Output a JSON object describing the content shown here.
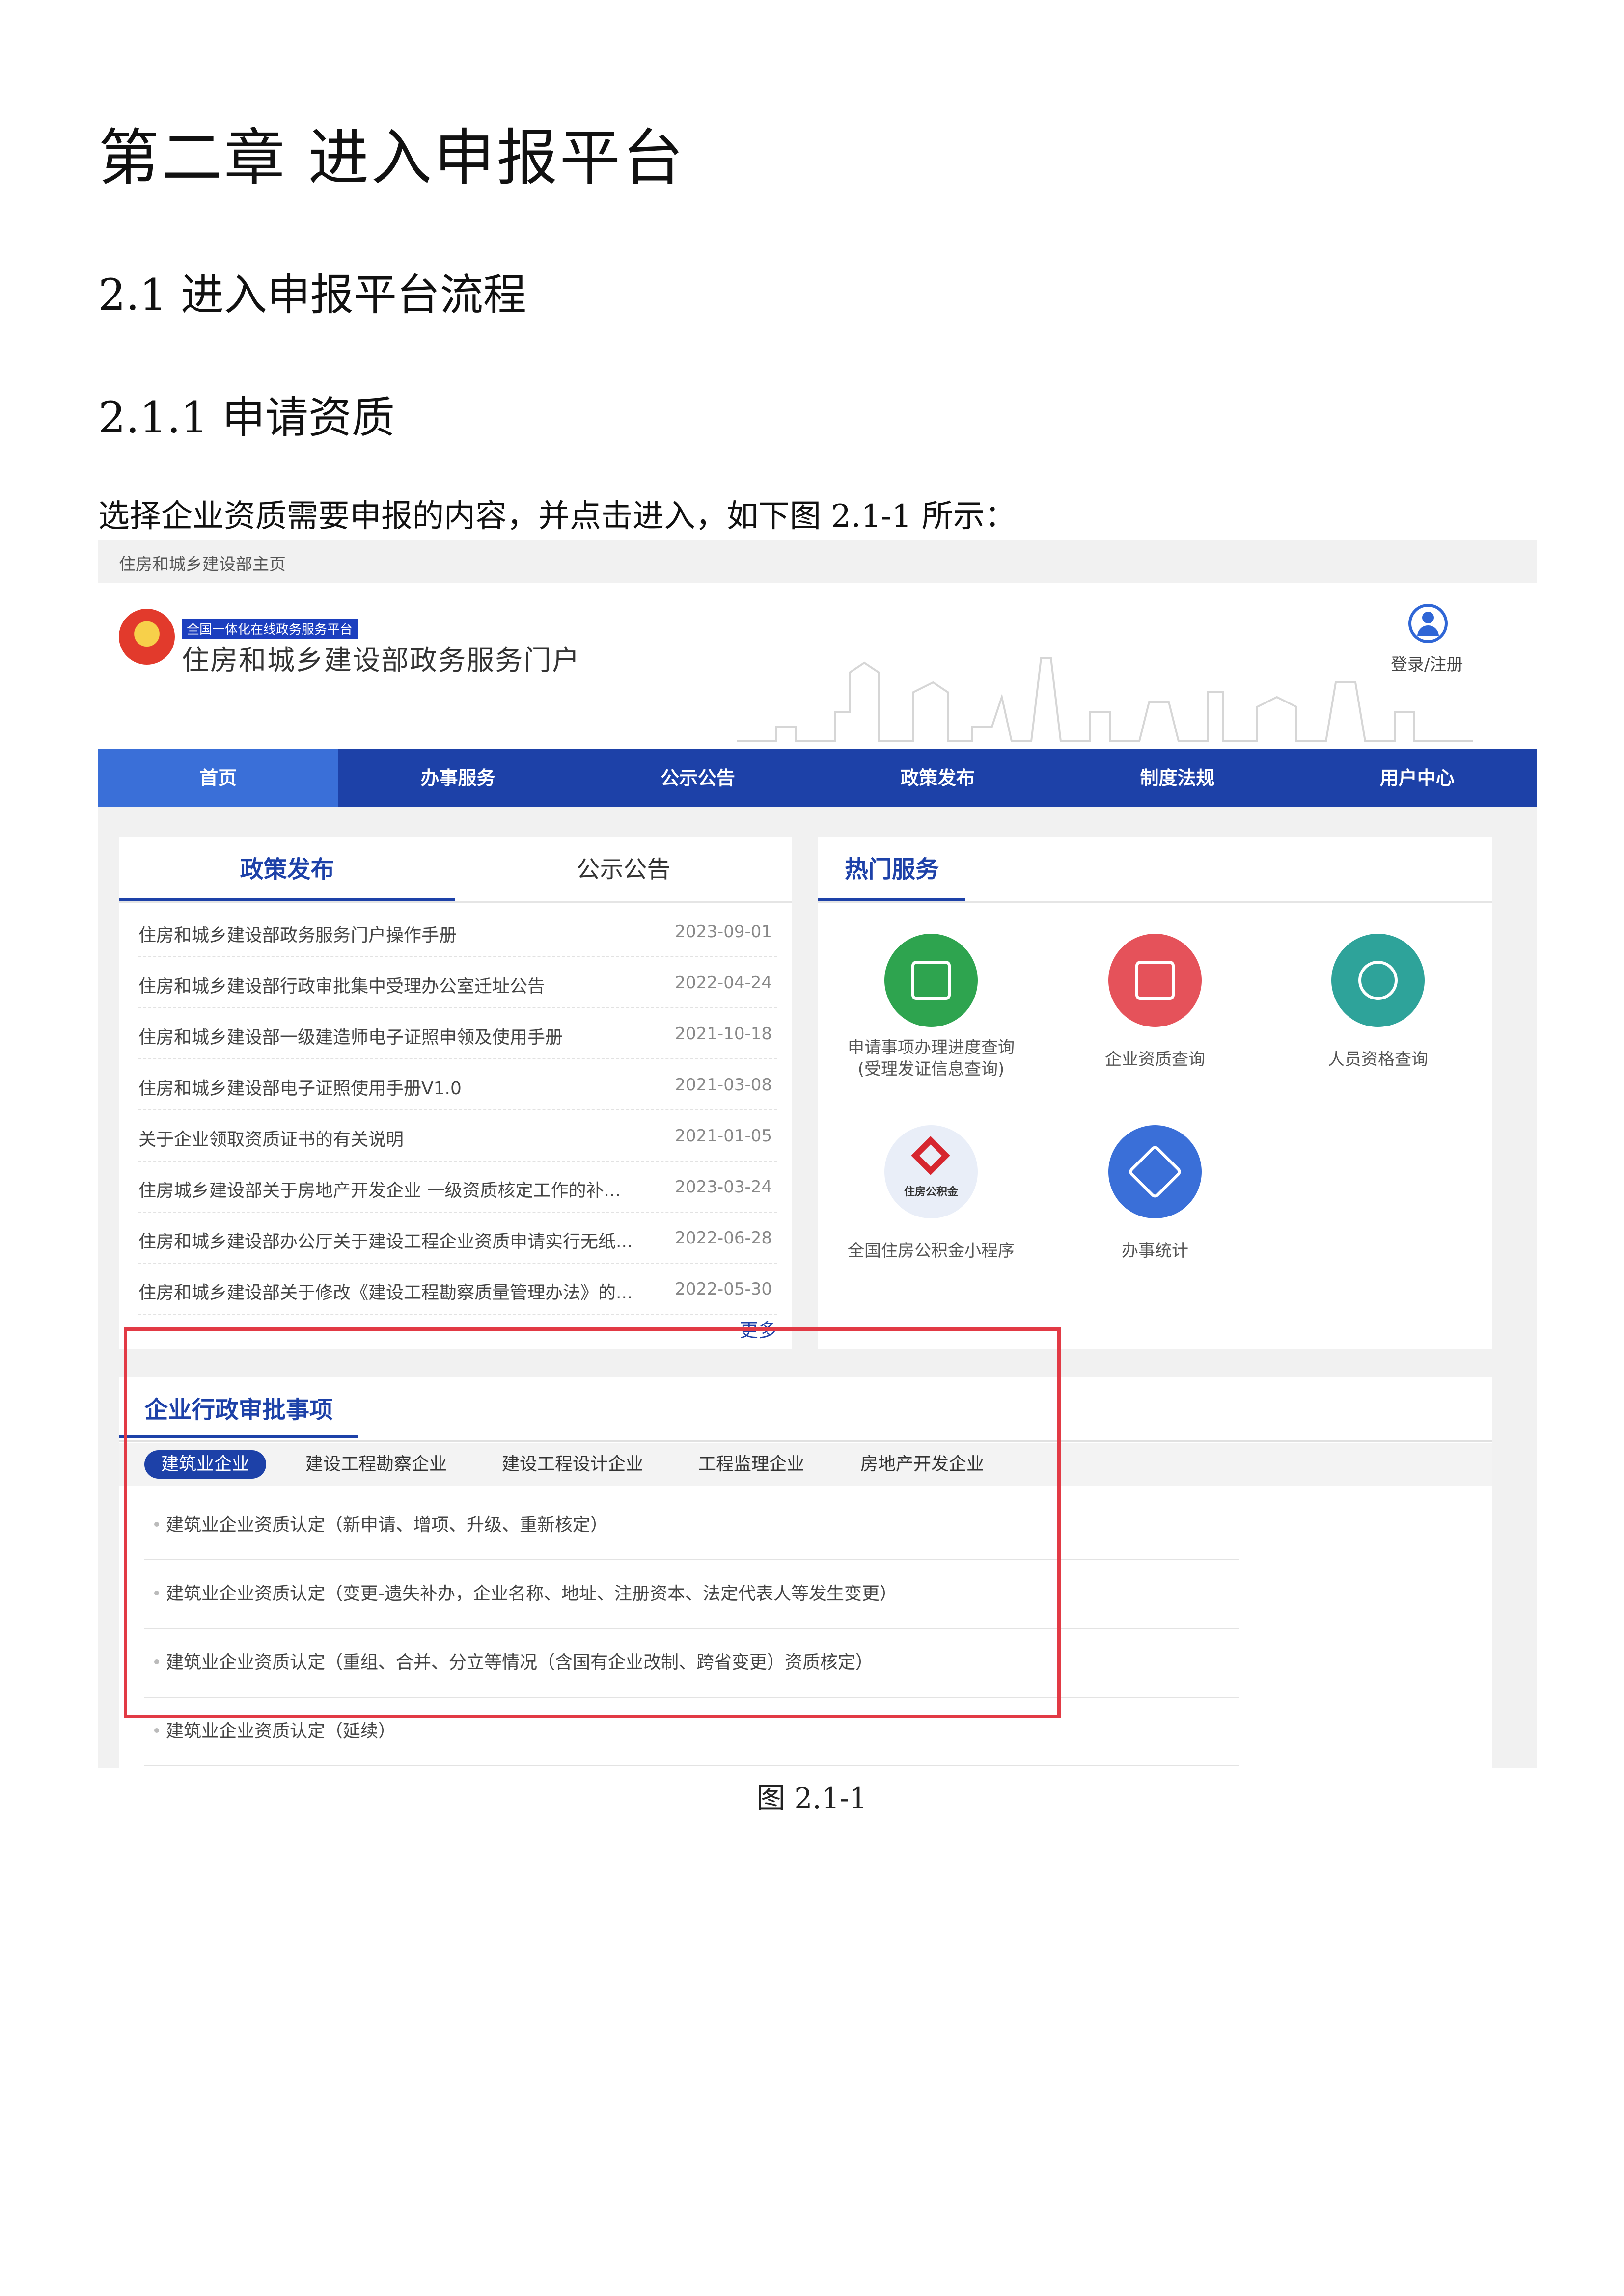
{
  "document": {
    "chapter_title": "第二章  进入申报平台",
    "section_title": "2.1 进入申报平台流程",
    "subsection_title": "2.1.1 申请资质",
    "paragraph": "选择企业资质需要申报的内容，并点击进入，如下图 2.1-1 所示：",
    "caption": "图 2.1-1"
  },
  "screenshot": {
    "topbar_link": "住房和城乡建设部主页",
    "portal_tag": "全国一体化在线政务服务平台",
    "portal_title": "住房和城乡建设部政务服务门户",
    "login_label": "登录/注册",
    "nav": [
      "首页",
      "办事服务",
      "公示公告",
      "政策发布",
      "制度法规",
      "用户中心"
    ],
    "news_tabs": [
      "政策发布",
      "公示公告"
    ],
    "news": [
      {
        "title": "住房和城乡建设部政务服务门户操作手册",
        "date": "2023-09-01"
      },
      {
        "title": "住房和城乡建设部行政审批集中受理办公室迁址公告",
        "date": "2022-04-24"
      },
      {
        "title": "住房和城乡建设部一级建造师电子证照申领及使用手册",
        "date": "2021-10-18"
      },
      {
        "title": "住房和城乡建设部电子证照使用手册V1.0",
        "date": "2021-03-08"
      },
      {
        "title": "关于企业领取资质证书的有关说明",
        "date": "2021-01-05"
      },
      {
        "title": "住房城乡建设部关于房地产开发企业 一级资质核定工作的补...",
        "date": "2023-03-24"
      },
      {
        "title": "住房和城乡建设部办公厅关于建设工程企业资质申请实行无纸...",
        "date": "2022-06-28"
      },
      {
        "title": "住房和城乡建设部关于修改《建设工程勘察质量管理办法》的...",
        "date": "2022-05-30"
      }
    ],
    "more_label": "更多",
    "hot_title": "热门服务",
    "services": [
      {
        "label": "申请事项办理进度查询",
        "label2": "(受理发证信息查询)",
        "color": "#2ea44f"
      },
      {
        "label": "企业资质查询",
        "label2": "",
        "color": "#e5525a"
      },
      {
        "label": "人员资格查询",
        "label2": "",
        "color": "#2ea39a"
      },
      {
        "label": "全国住房公积金小程序",
        "label2": "",
        "icon_text": "住房公积金",
        "color": "#e9eef8"
      },
      {
        "label": "办事统计",
        "label2": "",
        "color": "#3a6fd8"
      }
    ],
    "approval_title": "企业行政审批事项",
    "approval_tabs": [
      "建筑业企业",
      "建设工程勘察企业",
      "建设工程设计企业",
      "工程监理企业",
      "房地产开发企业"
    ],
    "approval_items": [
      "建筑业企业资质认定（新申请、增项、升级、重新核定）",
      "建筑业企业资质认定（变更-遗失补办，企业名称、地址、注册资本、法定代表人等发生变更）",
      "建筑业企业资质认定（重组、合并、分立等情况（含国有企业改制、跨省变更）资质核定）",
      "建筑业企业资质认定（延续）"
    ],
    "highlight_color": "#e23a45",
    "brand_color": "#1d41a8"
  }
}
